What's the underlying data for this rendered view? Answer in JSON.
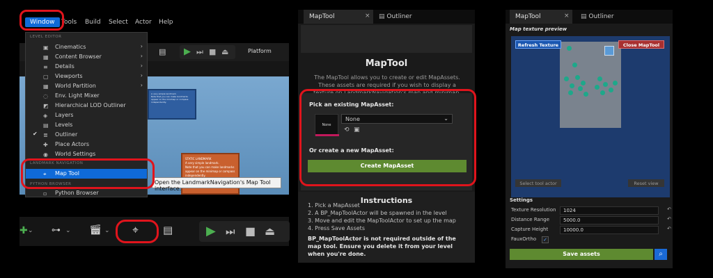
{
  "editor": {
    "menubar": [
      "Window",
      "Tools",
      "Build",
      "Select",
      "Actor",
      "Help"
    ],
    "toolbar_platform": "Platform",
    "menu_sections": {
      "level_editor": "LEVEL EDITOR",
      "landmark_nav": "LANDMARK NAVIGATION",
      "python": "PYTHON BROWSER"
    },
    "menu_items": [
      {
        "label": "Cinematics",
        "icon": "cinematics-icon",
        "arrow": true
      },
      {
        "label": "Content Browser",
        "icon": "content-browser-icon",
        "arrow": true
      },
      {
        "label": "Details",
        "icon": "details-icon",
        "arrow": true
      },
      {
        "label": "Viewports",
        "icon": "viewports-icon",
        "arrow": true
      },
      {
        "label": "World Partition",
        "icon": "world-partition-icon",
        "arrow": true
      },
      {
        "label": "Env. Light Mixer",
        "icon": "light-mixer-icon",
        "arrow": false
      },
      {
        "label": "Hierarchical LOD Outliner",
        "icon": "lod-icon",
        "arrow": false
      },
      {
        "label": "Layers",
        "icon": "layers-icon",
        "arrow": false
      },
      {
        "label": "Levels",
        "icon": "levels-icon",
        "arrow": false
      },
      {
        "label": "Outliner",
        "icon": "outliner-icon",
        "arrow": false
      },
      {
        "label": "Place Actors",
        "icon": "place-actors-icon",
        "arrow": false
      },
      {
        "label": "World Settings",
        "icon": "world-settings-icon",
        "arrow": false
      }
    ],
    "map_tool_label": "Map Tool",
    "python_item": "Python Browser",
    "tooltip": "Open the LandmarkNavigation's Map Tool interface.",
    "scene_sign": {
      "title": "STATIC LANDMARK",
      "line1": "A very simple landmark.",
      "line2": "Note that you can make landmarks appear on the minimap or compass independently."
    }
  },
  "maptool": {
    "tab": "MapTool",
    "tab2": "Outliner",
    "title": "MapTool",
    "desc": "The MapTool allows you to create or edit MapAssets. These assets are required if you wish to display a texture on LandmarkNavigation's map and minimap.",
    "pick_label": "Pick an existing MapAsset:",
    "thumb_label": "None",
    "dropdown_value": "None",
    "create_label": "Or create a new MapAsset:",
    "create_button": "Create MapAsset",
    "instructions_title": "Instructions",
    "steps": [
      "1. Pick a MapAsset",
      "2. A BP_MapToolActor will be spawned in the level",
      "3. Move and edit the MapToolActor to set up the map",
      "4. Press Save Assets"
    ],
    "warning": "BP_MapToolActor is not required outside of the map tool. Ensure you delete it from your level when you're done."
  },
  "preview": {
    "tab": "MapTool",
    "tab2": "Outliner",
    "label": "Map texture preview",
    "refresh": "Refresh Texture",
    "close": "Close MapTool",
    "select": "Select tool actor",
    "reset": "Reset view",
    "settings_label": "Settings",
    "settings": [
      {
        "key": "Texture Resolution",
        "value": "1024"
      },
      {
        "key": "Distance Range",
        "value": "5000.0"
      },
      {
        "key": "Capture Height",
        "value": "10000.0"
      }
    ],
    "faux_label": "FauxOrtho",
    "save": "Save assets"
  },
  "colors": {
    "accent_blue": "#0f6ad8",
    "highlight_red": "#e0141c",
    "save_green": "#5e8a30"
  }
}
